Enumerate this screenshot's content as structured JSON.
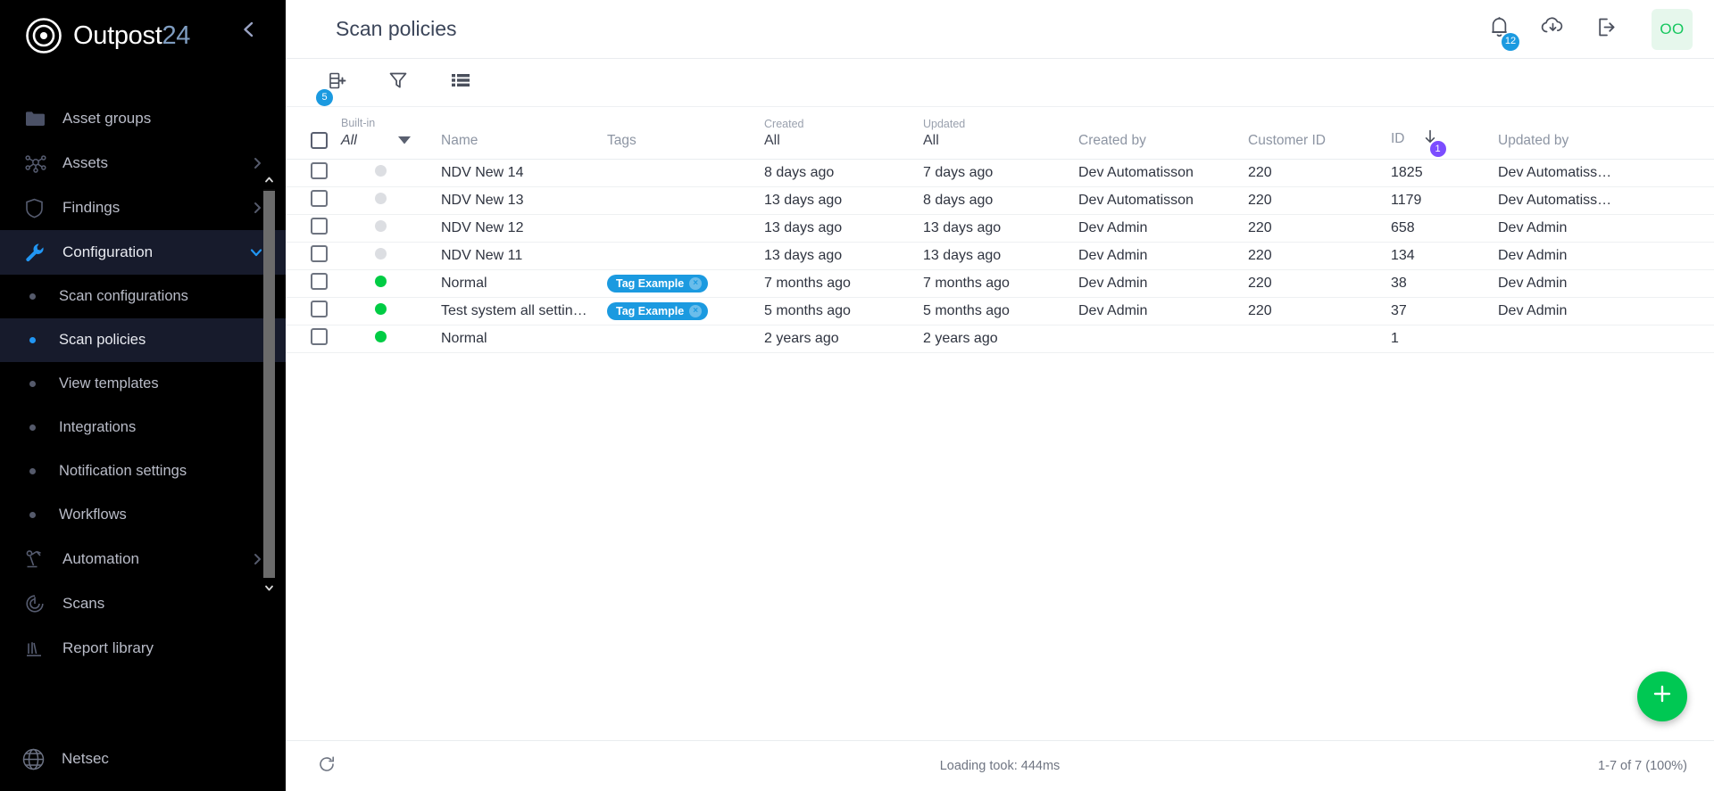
{
  "brand": {
    "word": "Outpost",
    "number": "24",
    "logo_icon": "target-icon",
    "collapse_icon": "chevron-left-icon"
  },
  "sidebar": {
    "items": [
      {
        "label": "Asset groups",
        "icon": "folder-icon",
        "chevron": "",
        "active": false
      },
      {
        "label": "Assets",
        "icon": "network-nodes-icon",
        "chevron": "chevron-right-icon",
        "active": false
      },
      {
        "label": "Findings",
        "icon": "shield-icon",
        "chevron": "chevron-right-icon",
        "active": false
      },
      {
        "label": "Configuration",
        "icon": "wrench-icon",
        "chevron": "chevron-down-icon",
        "active": true
      },
      {
        "label": "Automation",
        "icon": "automation-arm-icon",
        "chevron": "chevron-right-icon",
        "active": false
      },
      {
        "label": "Scans",
        "icon": "radar-icon",
        "chevron": "",
        "active": false
      },
      {
        "label": "Report library",
        "icon": "library-icon",
        "chevron": "",
        "active": false
      }
    ],
    "sub_items": [
      {
        "label": "Scan configurations",
        "active": false
      },
      {
        "label": "Scan policies",
        "active": true
      },
      {
        "label": "View templates",
        "active": false
      },
      {
        "label": "Integrations",
        "active": false
      },
      {
        "label": "Notification settings",
        "active": false
      },
      {
        "label": "Workflows",
        "active": false
      }
    ],
    "footer": {
      "label": "Netsec",
      "icon": "globe-icon"
    }
  },
  "header": {
    "title": "Scan policies",
    "notifications_icon": "bell-icon",
    "notifications_count": "12",
    "download_icon": "cloud-download-icon",
    "logout_icon": "logout-icon",
    "avatar_initials": "OO"
  },
  "toolbar": {
    "add_column_icon": "add-column-icon",
    "add_column_count": "5",
    "filter_icon": "filter-funnel-icon",
    "rows_icon": "list-rows-icon"
  },
  "table": {
    "columns": {
      "status": "",
      "builtin_caption": "Built-in",
      "builtin_value": "All",
      "name": "Name",
      "tags": "Tags",
      "created_caption": "Created",
      "created_value": "All",
      "updated_caption": "Updated",
      "updated_value": "All",
      "created_by": "Created by",
      "customer_id": "Customer ID",
      "id": "ID",
      "id_sort_icon": "sort-descending-icon",
      "id_sort_badge": "1",
      "updated_by": "Updated by"
    },
    "rows": [
      {
        "status": "off",
        "name": "NDV New 14",
        "tag": "",
        "created": "8 days ago",
        "updated": "7 days ago",
        "created_by": "Dev Automatisson",
        "customer_id": "220",
        "id": "1825",
        "updated_by": "Dev Automatiss…"
      },
      {
        "status": "off",
        "name": "NDV New 13",
        "tag": "",
        "created": "13 days ago",
        "updated": "8 days ago",
        "created_by": "Dev Automatisson",
        "customer_id": "220",
        "id": "1179",
        "updated_by": "Dev Automatiss…"
      },
      {
        "status": "off",
        "name": "NDV New 12",
        "tag": "",
        "created": "13 days ago",
        "updated": "13 days ago",
        "created_by": "Dev Admin",
        "customer_id": "220",
        "id": "658",
        "updated_by": "Dev Admin"
      },
      {
        "status": "off",
        "name": "NDV New 11",
        "tag": "",
        "created": "13 days ago",
        "updated": "13 days ago",
        "created_by": "Dev Admin",
        "customer_id": "220",
        "id": "134",
        "updated_by": "Dev Admin"
      },
      {
        "status": "on",
        "name": "Normal",
        "tag": "Tag Example",
        "created": "7 months ago",
        "updated": "7 months ago",
        "created_by": "Dev Admin",
        "customer_id": "220",
        "id": "38",
        "updated_by": "Dev Admin"
      },
      {
        "status": "on",
        "name": "Test system all settin…",
        "tag": "Tag Example",
        "created": "5 months ago",
        "updated": "5 months ago",
        "created_by": "Dev Admin",
        "customer_id": "220",
        "id": "37",
        "updated_by": "Dev Admin"
      },
      {
        "status": "on",
        "name": "Normal",
        "tag": "",
        "created": "2 years ago",
        "updated": "2 years ago",
        "created_by": "",
        "customer_id": "",
        "id": "1",
        "updated_by": ""
      }
    ],
    "tag_remove_glyph": "×"
  },
  "fab": {
    "label": "+",
    "icon": "plus-icon"
  },
  "footer": {
    "refresh_icon": "refresh-icon",
    "status_text": "Loading took: 444ms",
    "pagination_text": "1-7 of 7 (100%)"
  },
  "colors": {
    "brand_blue": "#7f9dc1",
    "accent_blue": "#1b9ae0",
    "active_blue": "#2196f3",
    "green": "#00c853",
    "status_on": "#00cc44",
    "status_off": "#dcdee2",
    "purple_badge": "#7c4dff",
    "sidebar_bg": "#000000",
    "sidebar_active": "#171b2c",
    "avatar_bg": "#e6f7ec",
    "avatar_fg": "#16c75e"
  }
}
